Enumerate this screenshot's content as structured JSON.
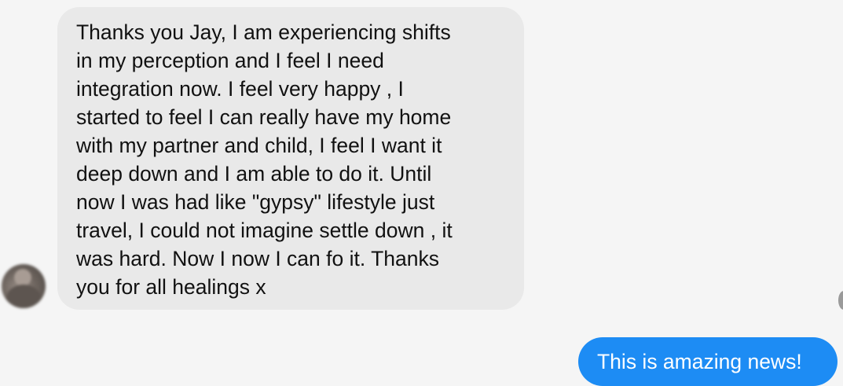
{
  "conversation": {
    "incoming": {
      "text": "Thanks you Jay, I am experiencing shifts\nin my perception and I feel I need\nintegration now. I feel very happy , I\nstarted to feel I can really have my home\nwith my partner and child, I feel I want it\ndeep down and I am able to do it. Until\nnow I was had like \"gypsy\" lifestyle just\ntravel, I could not imagine settle down , it\nwas hard. Now I now I can fo it. Thanks\nyou for all healings x",
      "bubble_color": "#e9e9e9",
      "text_color": "#111111"
    },
    "outgoing": {
      "text": "This is amazing news!",
      "bubble_color": "#1d8cf4",
      "text_color": "#ffffff"
    }
  },
  "colors": {
    "background": "#f5f5f5"
  }
}
